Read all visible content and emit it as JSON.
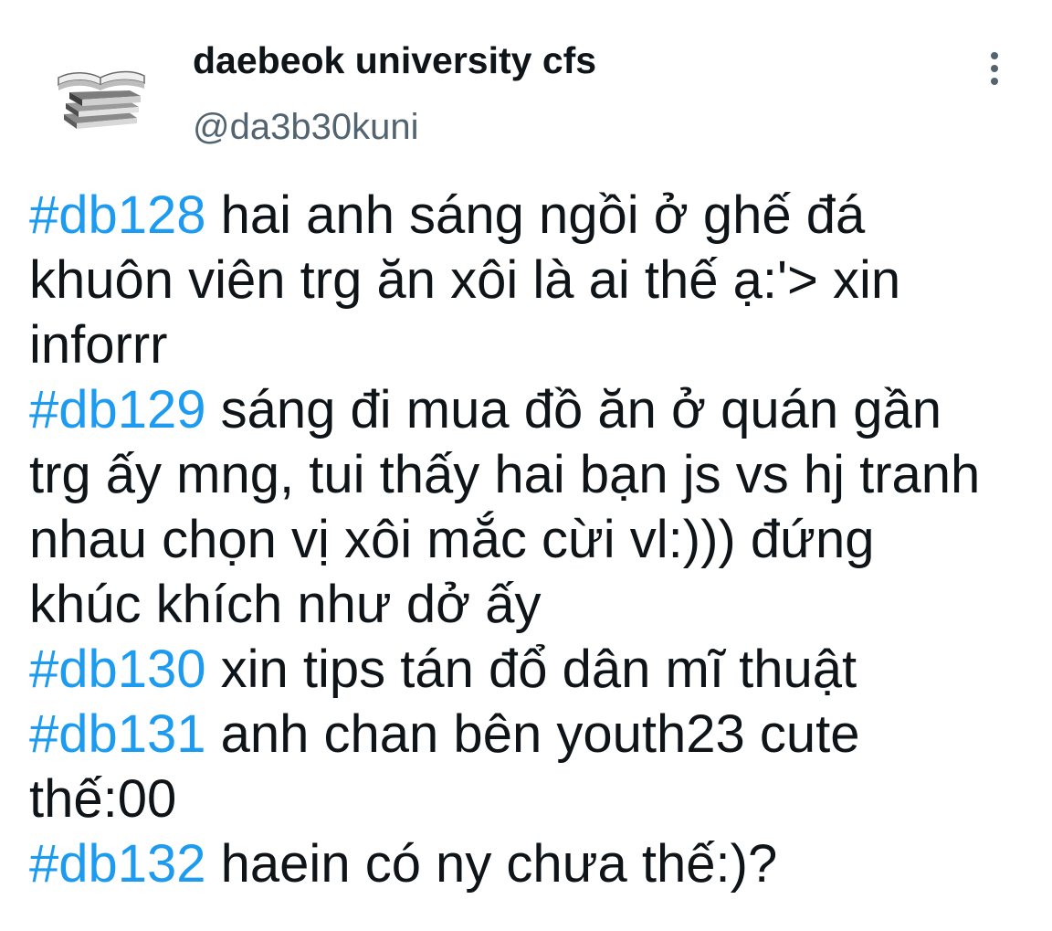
{
  "author": {
    "name": "daebeok university cfs",
    "handle": "@da3b30kuni",
    "avatar_icon": "stacked-books-icon"
  },
  "menu": {
    "icon": "more-vertical-icon"
  },
  "colors": {
    "hashtag": "#1d9bf0",
    "text": "#0f1419",
    "secondary": "#536471",
    "background": "#ffffff"
  },
  "tweet": {
    "lines": [
      {
        "hashtag": "#db128",
        "text": " hai anh sáng ngồi ở ghế đá"
      },
      {
        "hashtag": "",
        "text": "khuôn viên trg ăn xôi là ai thế ạ:'> xin"
      },
      {
        "hashtag": "",
        "text": "inforrr"
      },
      {
        "hashtag": "#db129",
        "text": " sáng đi mua đồ ăn ở quán gần"
      },
      {
        "hashtag": "",
        "text": "trg ấy mng, tui thấy hai bạn js vs hj tranh"
      },
      {
        "hashtag": "",
        "text": "nhau chọn vị xôi mắc cừi vl:))) đứng"
      },
      {
        "hashtag": "",
        "text": "khúc khích như dở ấy"
      },
      {
        "hashtag": "#db130",
        "text": " xin tips tán đổ dân mĩ thuật"
      },
      {
        "hashtag": "#db131",
        "text": " anh chan bên youth23 cute"
      },
      {
        "hashtag": "",
        "text": "thế:00"
      },
      {
        "hashtag": "#db132",
        "text": " haein có ny chưa thế:)?"
      }
    ]
  }
}
